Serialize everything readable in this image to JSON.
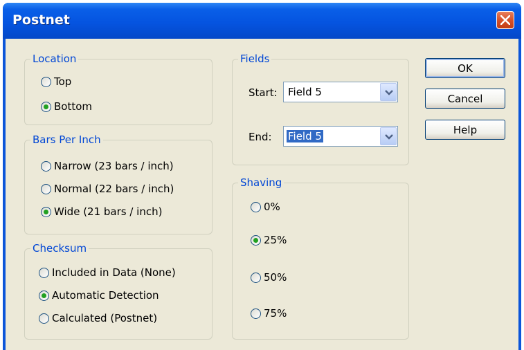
{
  "window": {
    "title": "Postnet"
  },
  "location": {
    "label": "Location",
    "options": [
      {
        "label": "Top",
        "checked": false
      },
      {
        "label": "Bottom",
        "checked": true
      }
    ]
  },
  "bars_per_inch": {
    "label": "Bars Per Inch",
    "options": [
      {
        "label": "Narrow (23 bars / inch)",
        "checked": false
      },
      {
        "label": "Normal (22 bars / inch)",
        "checked": false
      },
      {
        "label": "Wide (21 bars / inch)",
        "checked": true
      }
    ]
  },
  "checksum": {
    "label": "Checksum",
    "options": [
      {
        "label": "Included in Data (None)",
        "checked": false
      },
      {
        "label": "Automatic Detection",
        "checked": true
      },
      {
        "label": "Calculated (Postnet)",
        "checked": false
      }
    ]
  },
  "fields": {
    "label": "Fields",
    "start_label": "Start:",
    "start_value": "Field 5",
    "end_label": "End:",
    "end_value": "Field 5"
  },
  "shaving": {
    "label": "Shaving",
    "options": [
      {
        "label": "0%",
        "checked": false
      },
      {
        "label": "25%",
        "checked": true
      },
      {
        "label": "50%",
        "checked": false
      },
      {
        "label": "75%",
        "checked": false
      }
    ]
  },
  "buttons": {
    "ok": "OK",
    "cancel": "Cancel",
    "help": "Help"
  }
}
